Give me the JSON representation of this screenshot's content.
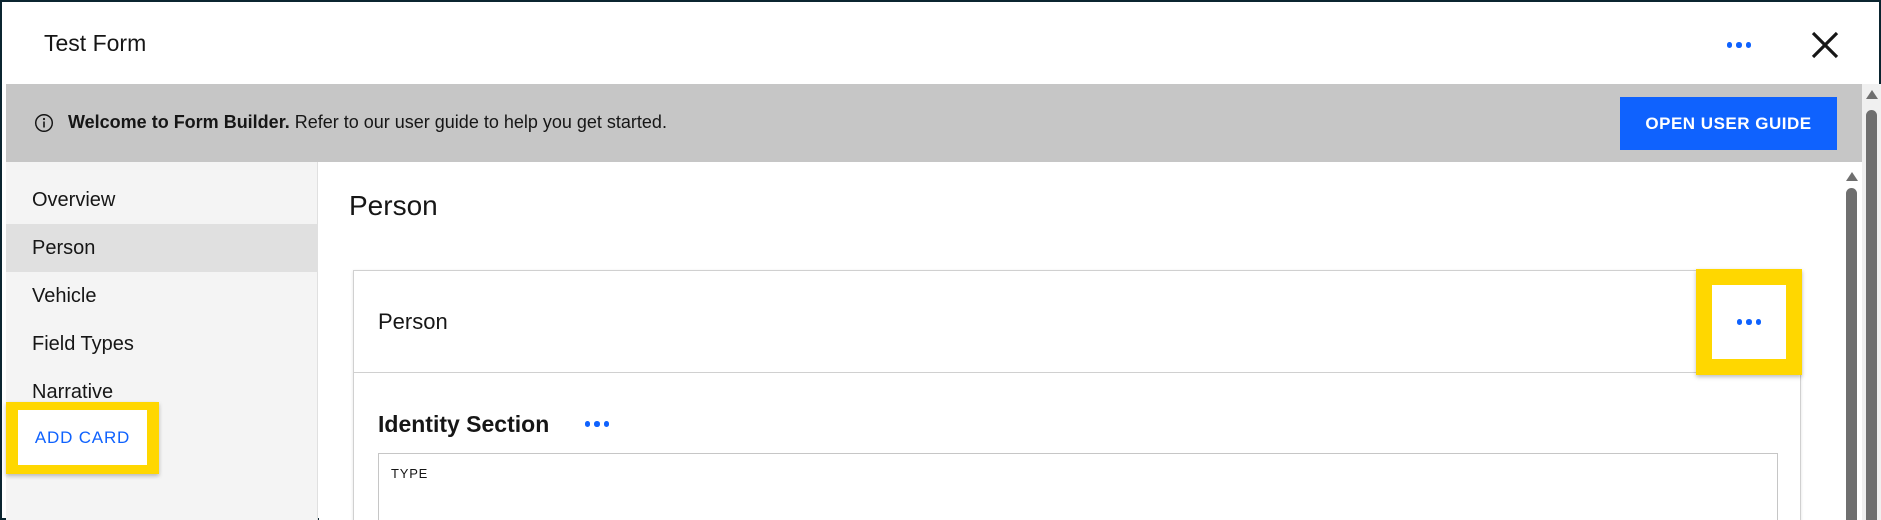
{
  "header": {
    "title": "Test Form",
    "more_icon": "overflow-menu-icon",
    "close_icon": "close-icon"
  },
  "banner": {
    "icon": "info-icon",
    "bold_text": "Welcome to Form Builder.",
    "text": " Refer to our user guide to help you get started.",
    "button_label": "OPEN USER GUIDE"
  },
  "sidebar": {
    "items": [
      {
        "label": "Overview",
        "active": false
      },
      {
        "label": "Person",
        "active": true
      },
      {
        "label": "Vehicle",
        "active": false
      },
      {
        "label": "Field Types",
        "active": false
      },
      {
        "label": "Narrative",
        "active": false
      }
    ],
    "add_card_label": "ADD CARD"
  },
  "main": {
    "page_title": "Person",
    "card": {
      "title": "Person",
      "section_title": "Identity Section",
      "field_label": "TYPE"
    }
  },
  "colors": {
    "accent": "#0f62fe",
    "banner_bg": "#c6c6c6",
    "highlight": "#ffd700",
    "sidebar_bg": "#f4f4f4",
    "active_item_bg": "#e0e0e0"
  }
}
